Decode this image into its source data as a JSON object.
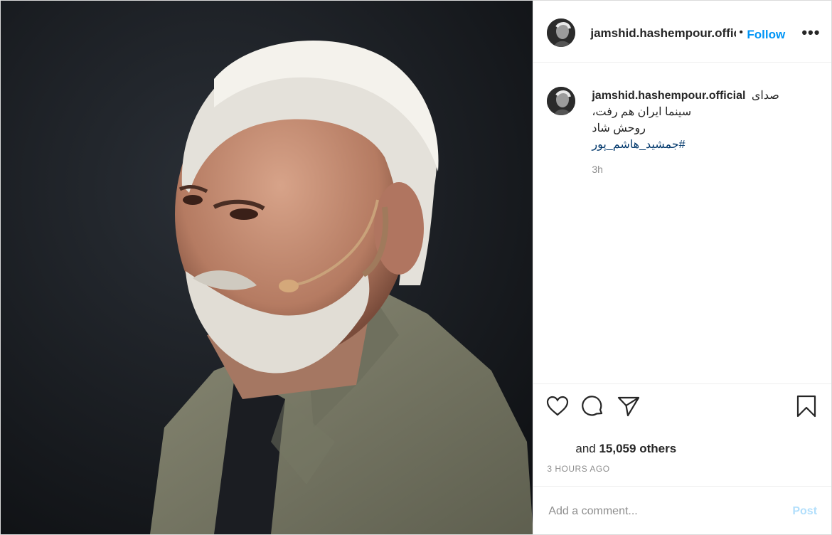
{
  "post": {
    "username": "jamshid.hashempour.offic",
    "separator": "•",
    "follow_label": "Follow",
    "more_label": "•••",
    "image_icon": "portrait-photo"
  },
  "caption": {
    "username": "jamshid.hashempour.official",
    "line1": "صدای",
    "line2": "سینما ایران هم رفت،",
    "line3": "روحش شاد",
    "hashtag": "#جمشید_هاشم_پور",
    "ago": "3h"
  },
  "actions": {
    "icons": [
      "heart-icon",
      "comment-icon",
      "share-icon",
      "bookmark-icon"
    ]
  },
  "likes": {
    "prefix": "and",
    "count": "15,059 others"
  },
  "timestamp": "3 HOURS AGO",
  "comment_box": {
    "placeholder": "Add a comment...",
    "post_label": "Post"
  },
  "colors": {
    "accent": "#0095f6",
    "muted": "#8e8e8e",
    "hashtag": "#00376b",
    "post_disabled": "#b2dffc"
  }
}
